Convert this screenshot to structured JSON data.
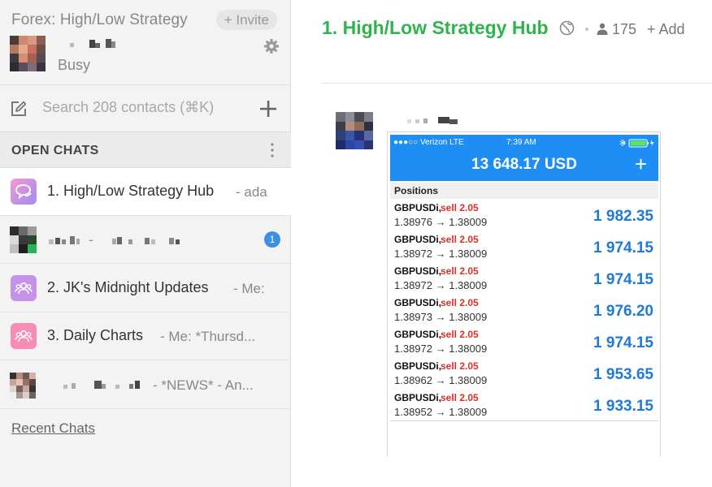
{
  "sidebar": {
    "workspace_name": "Forex: High/Low Strategy",
    "invite_label": "+ Invite",
    "me_status": "Busy",
    "search_placeholder": "Search 208 contacts (⌘K)",
    "open_chats_title": "OPEN CHATS",
    "chats": [
      {
        "label": "1. High/Low Strategy Hub",
        "preview": "- ada",
        "icon": "chat-bubble-icon",
        "active": true
      },
      {
        "label": "",
        "preview": "- ",
        "icon": "avatar",
        "unread": "1"
      },
      {
        "label": "2. JK's Midnight Updates",
        "preview": "- Me:",
        "icon": "group-icon"
      },
      {
        "label": "3. Daily Charts",
        "preview": "- Me: *Thursd...",
        "icon": "group-icon"
      },
      {
        "label": "",
        "preview": "- *NEWS* - An...",
        "icon": "avatar"
      }
    ],
    "recent_chats_label": "Recent Chats"
  },
  "main": {
    "chat_title": "1. High/Low Strategy Hub",
    "members_count": "175",
    "add_label": "+ Add"
  },
  "phone": {
    "carrier": "●●●○○ Verizon  LTE",
    "time": "7:39 AM",
    "balance": "13 648.17 USD",
    "plus": "+",
    "positions_label": "Positions",
    "positions": [
      {
        "symbol": "GBPUSDi,",
        "side": "sell 2.05",
        "prices": "1.38976 → 1.38009",
        "profit": "1 982.35"
      },
      {
        "symbol": "GBPUSDi,",
        "side": "sell 2.05",
        "prices": "1.38972 → 1.38009",
        "profit": "1 974.15"
      },
      {
        "symbol": "GBPUSDi,",
        "side": "sell 2.05",
        "prices": "1.38972 → 1.38009",
        "profit": "1 974.15"
      },
      {
        "symbol": "GBPUSDi,",
        "side": "sell 2.05",
        "prices": "1.38973 → 1.38009",
        "profit": "1 976.20"
      },
      {
        "symbol": "GBPUSDi,",
        "side": "sell 2.05",
        "prices": "1.38972 → 1.38009",
        "profit": "1 974.15"
      },
      {
        "symbol": "GBPUSDi,",
        "side": "sell 2.05",
        "prices": "1.38962 → 1.38009",
        "profit": "1 953.65"
      },
      {
        "symbol": "GBPUSDi,",
        "side": "sell 2.05",
        "prices": "1.38952 → 1.38009",
        "profit": "1 933.15"
      }
    ]
  },
  "colors": {
    "accent_green": "#2fb44d",
    "phone_blue": "#1e8ef5",
    "profit_blue": "#1e7ad6",
    "sell_red": "#d9302c",
    "badge_blue": "#3d8fe6"
  }
}
